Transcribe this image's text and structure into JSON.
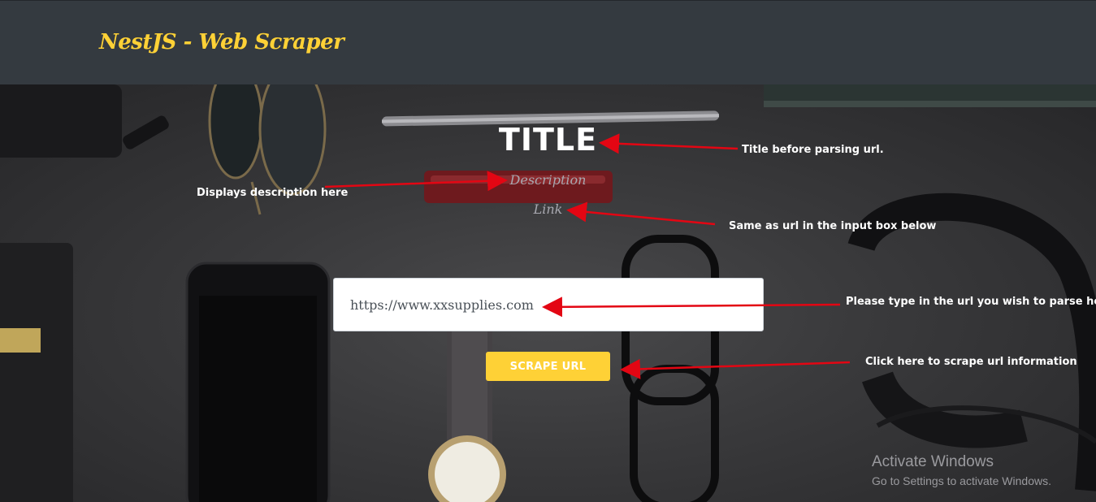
{
  "navbar": {
    "brand": "NestJS - Web Scraper"
  },
  "result": {
    "title": "TITLE",
    "description": "Description",
    "link": "Link"
  },
  "form": {
    "url_value": "https://www.xxsupplies.com",
    "button_label": "SCRAPE URL"
  },
  "annotations": {
    "title_note": "Title before parsing url.",
    "description_note": "Displays description here",
    "link_note": "Same as url in the input box below",
    "input_note": "Please type in the url you wish to parse here",
    "button_note": "Click here to scrape url information"
  },
  "watermark": {
    "title": "Activate Windows",
    "subtitle": "Go to Settings to activate Windows."
  },
  "colors": {
    "navbar_bg": "#343a40",
    "brand": "#fed136",
    "button_bg": "#fed136",
    "arrow": "#e30613"
  }
}
